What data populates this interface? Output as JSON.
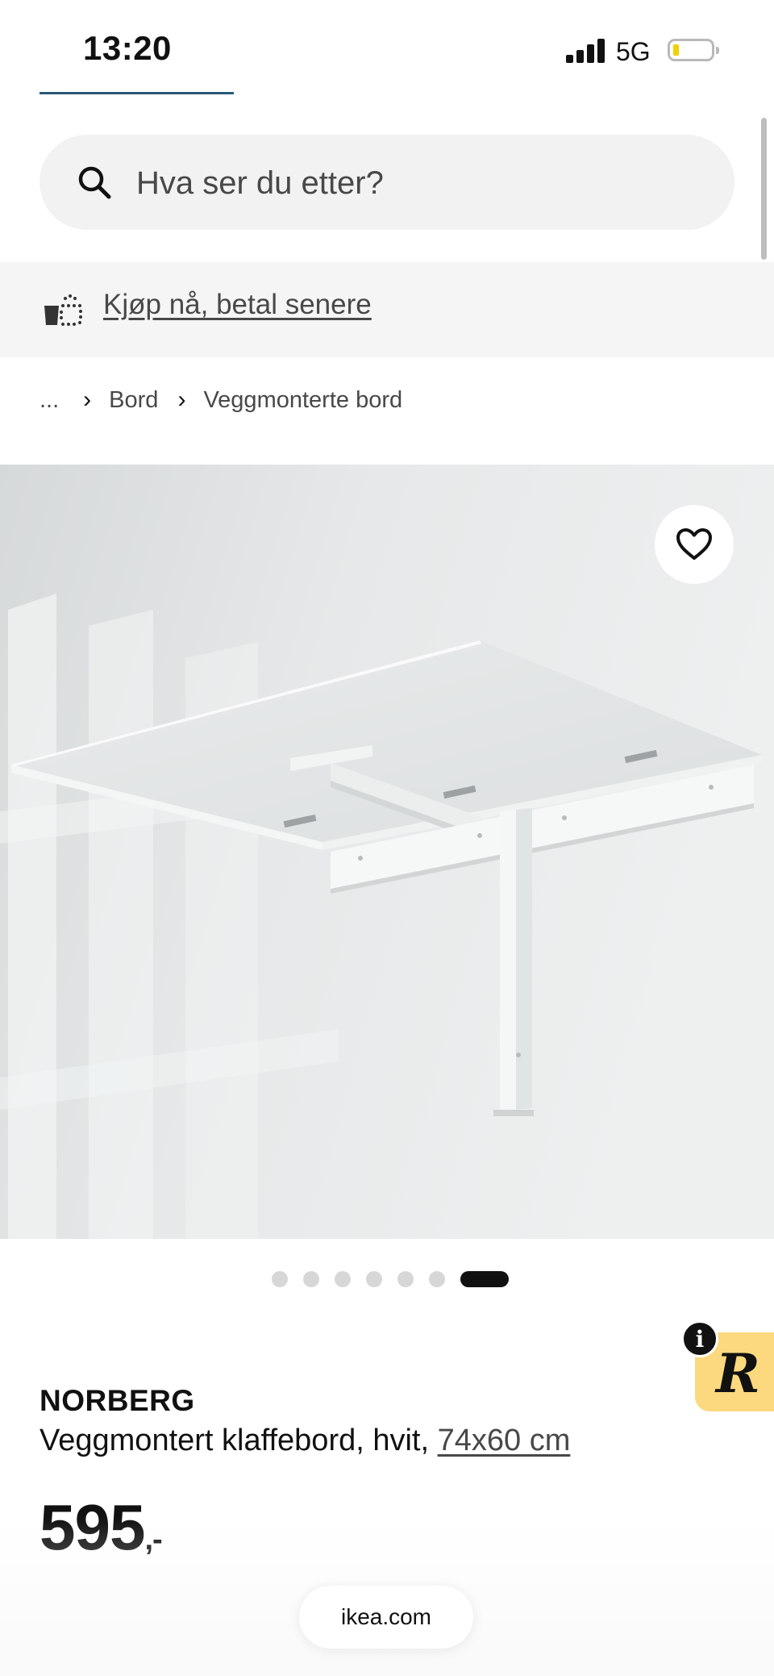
{
  "status_bar": {
    "time": "13:20",
    "network": "5G",
    "battery_level": 0.1
  },
  "search": {
    "placeholder": "Hva ser du etter?",
    "icon": "search-icon"
  },
  "promo": {
    "icon": "shopping-bag-installment-icon",
    "link_label": "Kjøp nå, betal senere"
  },
  "breadcrumb": {
    "ellipsis": "...",
    "items": [
      "Bord",
      "Veggmonterte bord"
    ],
    "separator": "›"
  },
  "gallery": {
    "image_alt": "Veggmontert klaffebord hvit",
    "favorite_icon": "heart-icon",
    "dot_count": 7,
    "active_index": 6
  },
  "widget": {
    "badge": "i",
    "letter": "R"
  },
  "product": {
    "brand": "NORBERG",
    "description": "Veggmontert klaffebord, hvit,",
    "size_link": "74x60 cm",
    "price": "595",
    "price_suffix": ",-"
  },
  "browser": {
    "url": "ikea.com"
  },
  "colors": {
    "accent_line": "#2b5877",
    "search_bg": "#f2f2f2",
    "promo_bg": "#f5f5f5",
    "widget_bg": "#fcd97e"
  }
}
